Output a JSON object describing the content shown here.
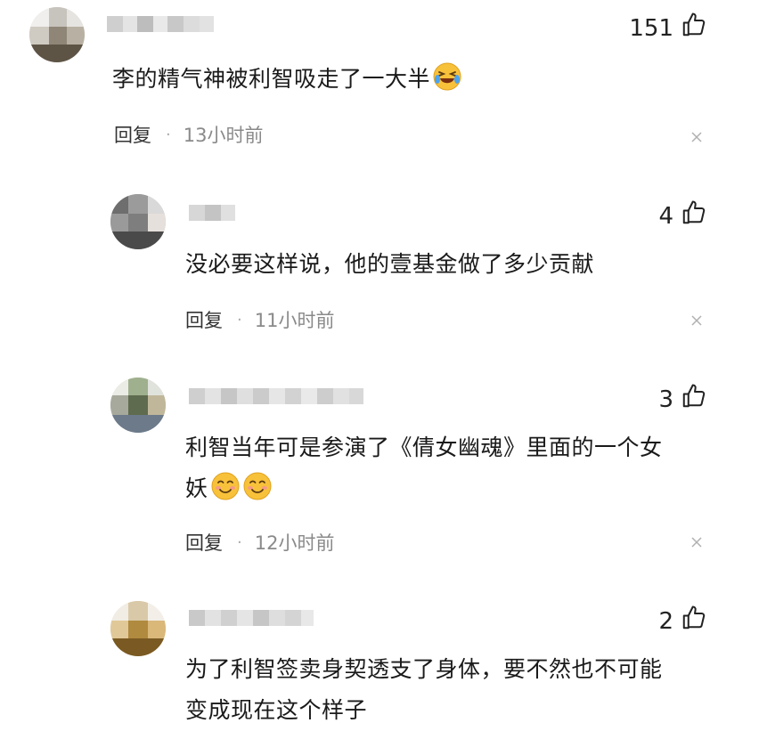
{
  "comments": [
    {
      "likes": "151",
      "text": "李的精气神被利智吸走了一大半",
      "emoji": "laughing-crying-emoji",
      "reply_label": "回复",
      "time": "13小时前"
    },
    {
      "likes": "4",
      "text": "没必要这样说，他的壹基金做了多少贡献",
      "reply_label": "回复",
      "time": "11小时前"
    },
    {
      "likes": "3",
      "text_line1": "利智当年可是参演了《倩女幽魂》里面的一个女",
      "text_line2": "妖",
      "emoji": "smile-emoji",
      "reply_label": "回复",
      "time": "12小时前"
    },
    {
      "likes": "2",
      "text_line1": "为了利智签卖身契透支了身体，要不然也不可能",
      "text_line2": "变成现在这个样子"
    }
  ],
  "icons": {
    "like": "thumbs-up-icon",
    "close": "close-icon"
  },
  "colors": {
    "text": "#1a1a1a",
    "meta": "#8a8a8a",
    "close": "#b0b0b0"
  }
}
